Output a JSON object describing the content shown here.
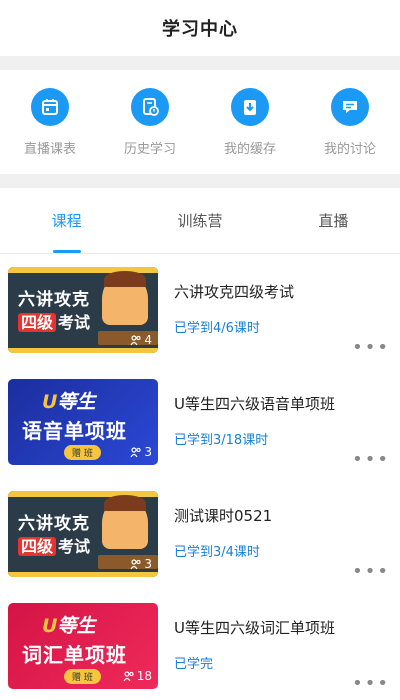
{
  "header": {
    "title": "学习中心"
  },
  "quick_actions": [
    {
      "label": "直播课表",
      "icon": "calendar-icon"
    },
    {
      "label": "历史学习",
      "icon": "history-document-icon"
    },
    {
      "label": "我的缓存",
      "icon": "download-icon"
    },
    {
      "label": "我的讨论",
      "icon": "chat-bubble-icon"
    }
  ],
  "tabs": [
    {
      "label": "课程",
      "active": true
    },
    {
      "label": "训练营",
      "active": false
    },
    {
      "label": "直播",
      "active": false
    }
  ],
  "courses": [
    {
      "title": "六讲攻克四级考试",
      "progress": "已学到4/6课时",
      "thumb_line1": "六讲攻克",
      "thumb_tag": "四级",
      "thumb_line2": "考试",
      "count": "4"
    },
    {
      "title": "U等生四六级语音单项班",
      "progress": "已学到3/18课时",
      "thumb_brand_u": "U",
      "thumb_brand": "等生",
      "thumb_title": "语音单项班",
      "thumb_pill": "赠 班",
      "count": "3"
    },
    {
      "title": "测试课时0521",
      "progress": "已学到3/4课时",
      "thumb_line1": "六讲攻克",
      "thumb_tag": "四级",
      "thumb_line2": "考试",
      "count": "3"
    },
    {
      "title": "U等生四六级词汇单项班",
      "progress": "已学完",
      "thumb_brand_u": "U",
      "thumb_brand": "等生",
      "thumb_title": "词汇单项班",
      "thumb_pill": "赠 班",
      "count": "18"
    }
  ],
  "more_label": "•••",
  "colors": {
    "accent": "#1a9af5",
    "progress_text": "#1a7fd1"
  }
}
